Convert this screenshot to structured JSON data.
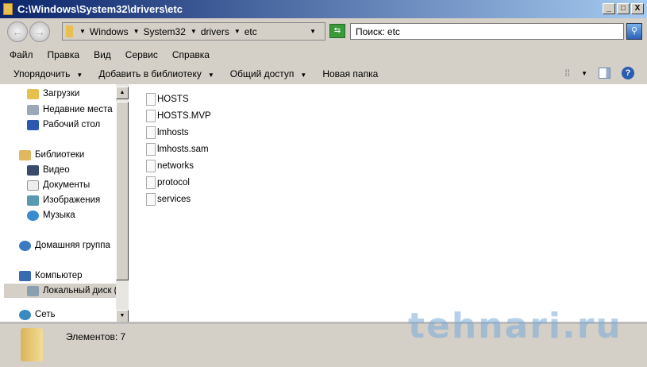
{
  "window": {
    "title": "C:\\Windows\\System32\\drivers\\etc",
    "minimize": "_",
    "maximize": "□",
    "close": "X"
  },
  "nav": {
    "back": "←",
    "forward": "→",
    "breadcrumbs": [
      "Windows",
      "System32",
      "drivers",
      "etc"
    ],
    "search_placeholder": "Поиск: etc"
  },
  "menu": [
    "Файл",
    "Правка",
    "Вид",
    "Сервис",
    "Справка"
  ],
  "toolbar": {
    "organize": "Упорядочить",
    "add_library": "Добавить в библиотеку",
    "share": "Общий доступ",
    "new_folder": "Новая папка",
    "help": "?"
  },
  "sidebar": {
    "items": [
      {
        "label": "Загрузки",
        "icon": "downloads-icon",
        "color": "#e8c050"
      },
      {
        "label": "Недавние места",
        "icon": "recent-places-icon",
        "color": "#9aa8b8"
      },
      {
        "label": "Рабочий стол",
        "icon": "desktop-icon",
        "color": "#2a5ab0"
      },
      {
        "label": "Библиотеки",
        "icon": "libraries-icon",
        "color": "#e0b860"
      },
      {
        "label": "Видео",
        "icon": "video-icon",
        "color": "#3a4a6a"
      },
      {
        "label": "Документы",
        "icon": "documents-icon",
        "color": "#dddddd"
      },
      {
        "label": "Изображения",
        "icon": "pictures-icon",
        "color": "#5a9ab0"
      },
      {
        "label": "Музыка",
        "icon": "music-icon",
        "color": "#3a8ad0"
      },
      {
        "label": "Домашняя группа",
        "icon": "homegroup-icon",
        "color": "#3a7ac0"
      },
      {
        "label": "Компьютер",
        "icon": "computer-icon",
        "color": "#3a6ab0"
      },
      {
        "label": "Локальный диск (",
        "icon": "local-disk-icon",
        "color": "#8aa0b0"
      },
      {
        "label": "Сеть",
        "icon": "network-icon",
        "color": "#3a8ac0"
      }
    ]
  },
  "files": [
    "HOSTS",
    "HOSTS.MVP",
    "lmhosts",
    "lmhosts.sam",
    "networks",
    "protocol",
    "services"
  ],
  "status": {
    "count": "Элементов: 7"
  },
  "watermark": "tehnari.ru"
}
